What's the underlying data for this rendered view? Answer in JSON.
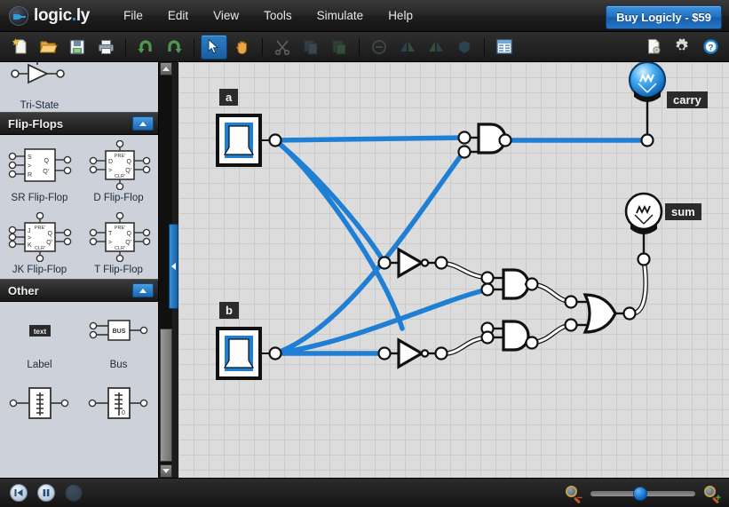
{
  "app": {
    "name": "logic.ly",
    "logo_name_main": "logic",
    "logo_name_dot": ".",
    "logo_name_tld": "ly"
  },
  "menubar": {
    "items": [
      {
        "label": "File",
        "name": "menu-file"
      },
      {
        "label": "Edit",
        "name": "menu-edit"
      },
      {
        "label": "View",
        "name": "menu-view"
      },
      {
        "label": "Tools",
        "name": "menu-tools"
      },
      {
        "label": "Simulate",
        "name": "menu-simulate"
      },
      {
        "label": "Help",
        "name": "menu-help"
      }
    ],
    "buy_button": "Buy Logicly - $59"
  },
  "toolbar": {
    "buttons": [
      {
        "icon": "new-document-icon",
        "enabled": true
      },
      {
        "icon": "open-folder-icon",
        "enabled": true
      },
      {
        "icon": "save-disk-icon",
        "enabled": true
      },
      {
        "icon": "print-icon",
        "enabled": true
      },
      {
        "icon": "undo-icon",
        "enabled": true
      },
      {
        "icon": "redo-icon",
        "enabled": true
      },
      {
        "icon": "pointer-tool-icon",
        "enabled": true,
        "selected": true
      },
      {
        "icon": "hand-tool-icon",
        "enabled": true
      },
      {
        "icon": "cut-scissors-icon",
        "enabled": false
      },
      {
        "icon": "copy-icon",
        "enabled": false
      },
      {
        "icon": "paste-icon",
        "enabled": false
      },
      {
        "icon": "delete-icon",
        "enabled": false
      },
      {
        "icon": "flip-horizontal-icon",
        "enabled": false
      },
      {
        "icon": "flip-vertical-icon",
        "enabled": false
      },
      {
        "icon": "group-icon",
        "enabled": false
      },
      {
        "icon": "truth-table-icon",
        "enabled": true
      },
      {
        "icon": "document-properties-icon",
        "enabled": true
      },
      {
        "icon": "settings-gear-icon",
        "enabled": true
      },
      {
        "icon": "help-question-icon",
        "enabled": true
      }
    ]
  },
  "sidebar": {
    "partial_top_item": {
      "label": "Tri-State",
      "icon": "tri-state-buffer-icon"
    },
    "sections": [
      {
        "title": "Flip-Flops",
        "collapse_icon": "collapse-up-icon",
        "items": [
          {
            "label": "SR Flip-Flop",
            "icon": "sr-flip-flop-icon"
          },
          {
            "label": "D Flip-Flop",
            "icon": "d-flip-flop-icon"
          },
          {
            "label": "JK Flip-Flop",
            "icon": "jk-flip-flop-icon"
          },
          {
            "label": "T Flip-Flop",
            "icon": "t-flip-flop-icon"
          }
        ]
      },
      {
        "title": "Other",
        "collapse_icon": "collapse-up-icon",
        "items": [
          {
            "label": "Label",
            "icon": "label-icon",
            "glyph": "text"
          },
          {
            "label": "Bus",
            "icon": "bus-icon",
            "glyph": "BUS"
          },
          {
            "label": "",
            "icon": "splitter-in-icon"
          },
          {
            "label": "",
            "icon": "splitter-out-icon"
          }
        ]
      }
    ],
    "scrollbar": {
      "up_icon": "scroll-up-icon",
      "down_icon": "scroll-down-icon"
    },
    "panel_handle_icon": "collapse-panel-left-icon"
  },
  "canvas": {
    "labels": [
      {
        "text": "a",
        "name": "label-input-a"
      },
      {
        "text": "b",
        "name": "label-input-b"
      },
      {
        "text": "carry",
        "name": "label-output-carry"
      },
      {
        "text": "sum",
        "name": "label-output-sum"
      }
    ],
    "circuit": {
      "title": "half-adder",
      "inputs": [
        {
          "name": "a",
          "type": "toggle-switch",
          "state": "on"
        },
        {
          "name": "b",
          "type": "toggle-switch",
          "state": "on"
        }
      ],
      "gates": [
        {
          "name": "and-carry",
          "type": "AND",
          "output": "high"
        },
        {
          "name": "not-a",
          "type": "NOT",
          "output": "low"
        },
        {
          "name": "not-b",
          "type": "NOT",
          "output": "low"
        },
        {
          "name": "and-upper",
          "type": "AND",
          "output": "low"
        },
        {
          "name": "and-lower",
          "type": "AND",
          "output": "low"
        },
        {
          "name": "or-sum",
          "type": "OR",
          "output": "low"
        }
      ],
      "outputs": [
        {
          "name": "carry",
          "type": "light-bulb",
          "state": "on"
        },
        {
          "name": "sum",
          "type": "light-bulb",
          "state": "off"
        }
      ]
    },
    "colors": {
      "wire_high": "#1f7fd4",
      "wire_low": "#ffffff",
      "grid": "#cbcbcb",
      "background": "#dcdcdc",
      "bulb_on": "#2e9bea"
    }
  },
  "statusbar": {
    "buttons": [
      {
        "icon": "restart-simulation-icon",
        "enabled": true
      },
      {
        "icon": "pause-simulation-icon",
        "enabled": true
      },
      {
        "icon": "step-simulation-icon",
        "enabled": false
      }
    ],
    "zoom_out_icon": "zoom-out-icon",
    "zoom_in_icon": "zoom-in-icon",
    "zoom_slider_name": "zoom-slider"
  }
}
